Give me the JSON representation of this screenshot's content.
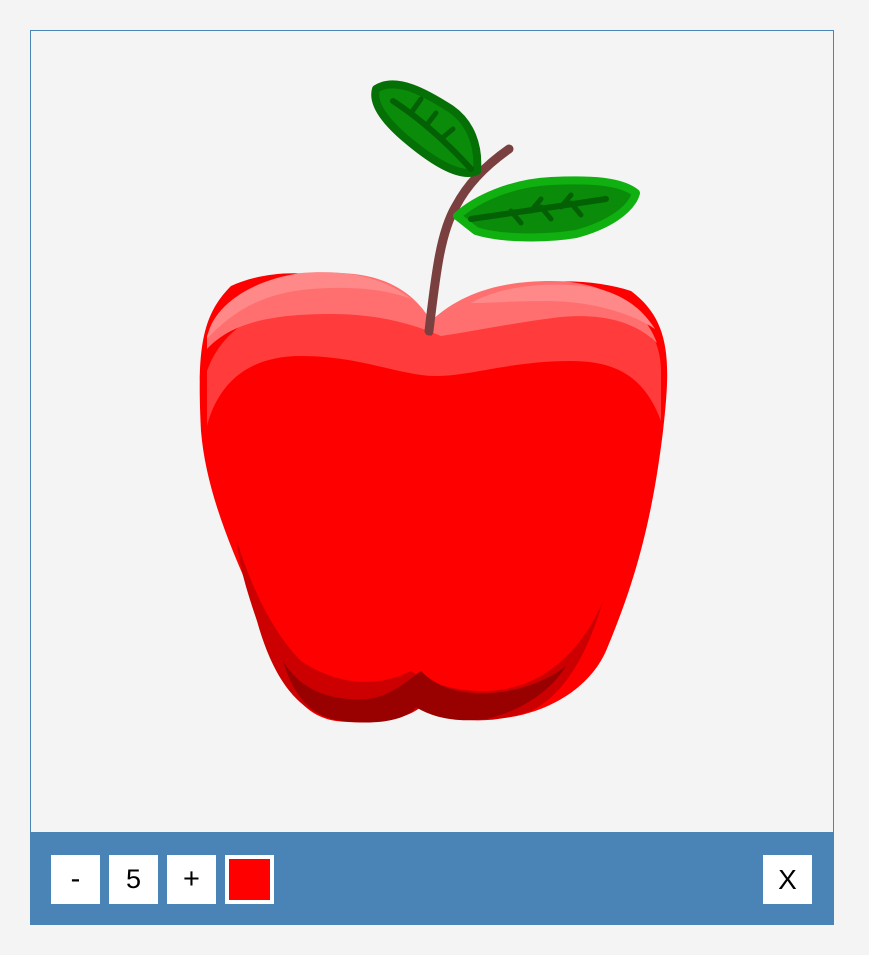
{
  "toolbar": {
    "decrease_label": "-",
    "brush_size": "5",
    "increase_label": "+",
    "current_color": "#ff0000",
    "close_label": "X"
  },
  "colors": {
    "toolbar_bg": "#4a84b7",
    "canvas_bg": "#f4f4f4"
  }
}
